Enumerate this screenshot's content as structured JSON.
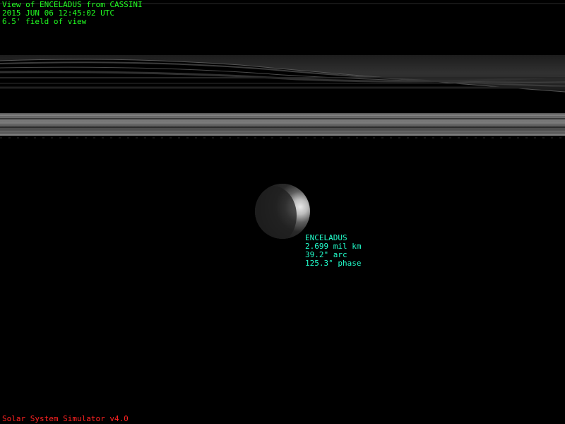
{
  "header": {
    "view_line": "View of ENCELADUS from CASSINI",
    "time_line": "2015 JUN 06 12:45:02 UTC",
    "fov_line": "6.5' field of view"
  },
  "target": {
    "name": "ENCELADUS",
    "distance": "2.699 mil km",
    "angular_size": "39.2\" arc",
    "phase": "125.3° phase"
  },
  "footer": {
    "app_name": "Solar System Simulator v4.0"
  },
  "colors": {
    "header_text": "#22ff22",
    "target_text": "#22ffcc",
    "footer_text": "#ff2222",
    "background": "#000000"
  }
}
